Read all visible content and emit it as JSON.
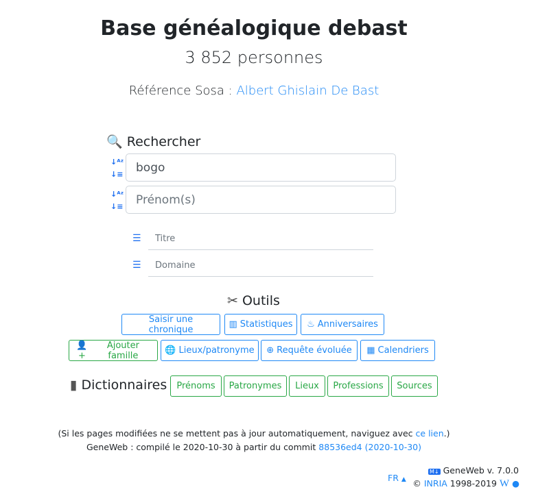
{
  "header": {
    "title": "Base généalogique debast",
    "count": "3 852 personnes",
    "sosa_label": "Référence Sosa :",
    "sosa_name": "Albert Ghislain De Bast"
  },
  "search": {
    "title": "Rechercher",
    "surname_value": "bogo",
    "firstname_placeholder": "Prénom(s)",
    "title_placeholder": "Titre",
    "domain_placeholder": "Domaine"
  },
  "tools": {
    "title": "Outils",
    "row1": [
      "Saisir une chronique",
      "Statistiques",
      "Anniversaires"
    ],
    "row2": [
      "Ajouter famille",
      "Lieux/patronyme",
      "Requête évoluée",
      "Calendriers"
    ]
  },
  "dictionaries": {
    "title": "Dictionnaires",
    "items": [
      "Prénoms",
      "Patronymes",
      "Lieux",
      "Professions",
      "Sources"
    ]
  },
  "footer": {
    "note_prefix": "(Si les pages modifiées ne se mettent pas à jour automatiquement, naviguez avec",
    "note_link": "ce lien",
    "note_suffix": ".)",
    "compiled": "GeneWeb : compilé le 2020-10-30 à partir du commit",
    "commit": "88536ed4 (2020-10-30)",
    "lang": "FR",
    "version": "GeneWeb v. 7.0.0",
    "copyright": "©",
    "inria": "INRIA",
    "years": "1998-2019"
  },
  "colors": {
    "primary": "#1e88f5",
    "success": "#28a745"
  }
}
